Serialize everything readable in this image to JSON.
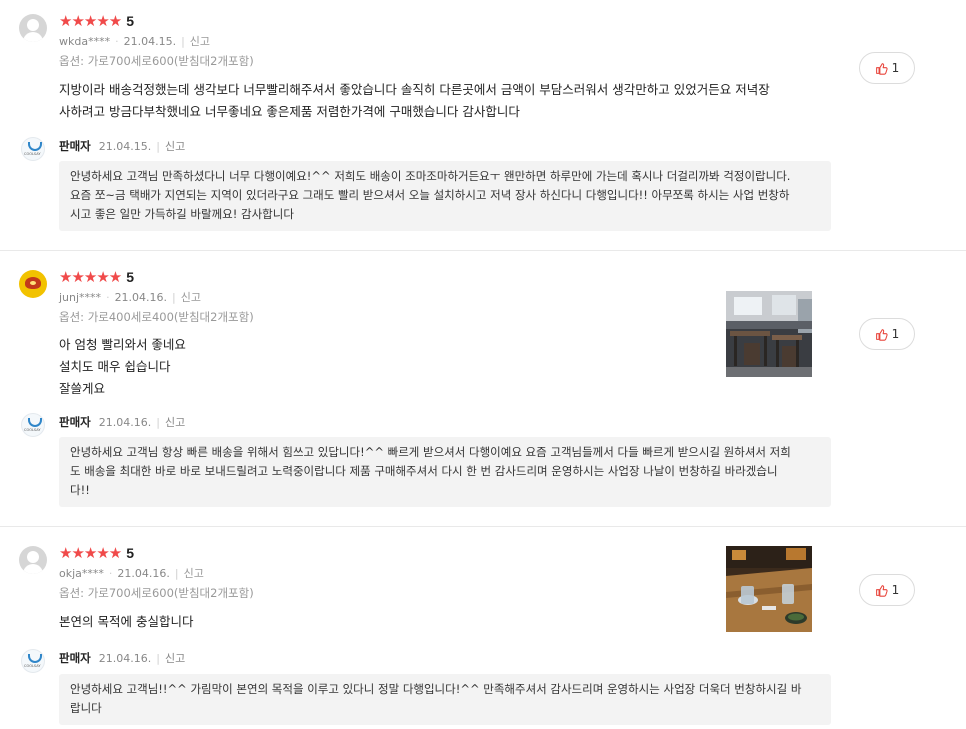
{
  "reviews": [
    {
      "stars": "★★★★★",
      "score": "5",
      "user": "wkda****",
      "date": "21.04.15.",
      "report_label": "신고",
      "option": "옵션: 가로700세로600(받침대2개포함)",
      "body_lines": [
        "지방이라 배송걱정했는데 생각보다 너무빨리해주셔서 좋았습니다 솔직히 다른곳에서 금액이 부담스러워서 생각만하고 있었거든요 저녁장",
        "사하려고 방금다부착했네요 너무좋네요 좋은제품 저렴한가격에 구매했습니다 감사합니다"
      ],
      "like_count": "1",
      "seller": {
        "name": "판매자",
        "date": "21.04.15.",
        "report_label": "신고",
        "reply_lines": [
          "안녕하세요 고객님 만족하셨다니 너무 다행이예요!^^ 저희도 배송이 조마조마하거든요ㅜ 왠만하면 하루만에 가는데 혹시나 더걸리까봐 걱정이랍니다.",
          "요즘 쪼~금 택배가 지연되는 지역이 있더라구요 그래도 빨리 받으셔서 오늘 설치하시고 저녁 장사 하신다니 다행입니다!! 아무쪼록 하시는 사업 번창하",
          "시고 좋은 일만 가득하길 바랄께요! 감사합니다"
        ]
      }
    },
    {
      "stars": "★★★★★",
      "score": "5",
      "user": "junj****",
      "date": "21.04.16.",
      "report_label": "신고",
      "option": "옵션: 가로400세로400(받침대2개포함)",
      "body_lines": [
        "아 엄청 빨리와서 좋네요",
        "설치도 매우 쉽습니다",
        "잘쓸게요"
      ],
      "like_count": "1",
      "seller": {
        "name": "판매자",
        "date": "21.04.16.",
        "report_label": "신고",
        "reply_lines": [
          "안녕하세요 고객님 항상 빠른 배송을 위해서 힘쓰고 있답니다!^^ 빠르게 받으셔서 다행이예요 요즘 고객님들께서 다들 빠르게 받으시길 원하셔서 저희",
          "도 배송을 최대한 바로 바로 보내드릴려고 노력중이랍니다 제품 구매해주셔서 다시 한 번 감사드리며 운영하시는 사업장 나날이 번창하길 바라겠습니",
          "다!!"
        ]
      }
    },
    {
      "stars": "★★★★★",
      "score": "5",
      "user": "okja****",
      "date": "21.04.16.",
      "report_label": "신고",
      "option": "옵션: 가로700세로600(받침대2개포함)",
      "body_lines": [
        "본연의 목적에 충실합니다"
      ],
      "like_count": "1",
      "seller": {
        "name": "판매자",
        "date": "21.04.16.",
        "report_label": "신고",
        "reply_lines": [
          "안녕하세요 고객님!!^^ 가림막이 본연의 목적을 이루고 있다니 정말 다행입니다!^^ 만족해주셔서 감사드리며 운영하시는 사업장 더욱더 번창하시길 바",
          "랍니다"
        ]
      }
    }
  ],
  "seller_logo_text": "COOLSAY",
  "colors": {
    "star": "#f04a4a",
    "reply_bg": "#f3f3f3",
    "like_icon": "#e8453c"
  },
  "icons": {
    "like": "thumbs-up-icon",
    "avatar": "user-avatar-icon"
  }
}
